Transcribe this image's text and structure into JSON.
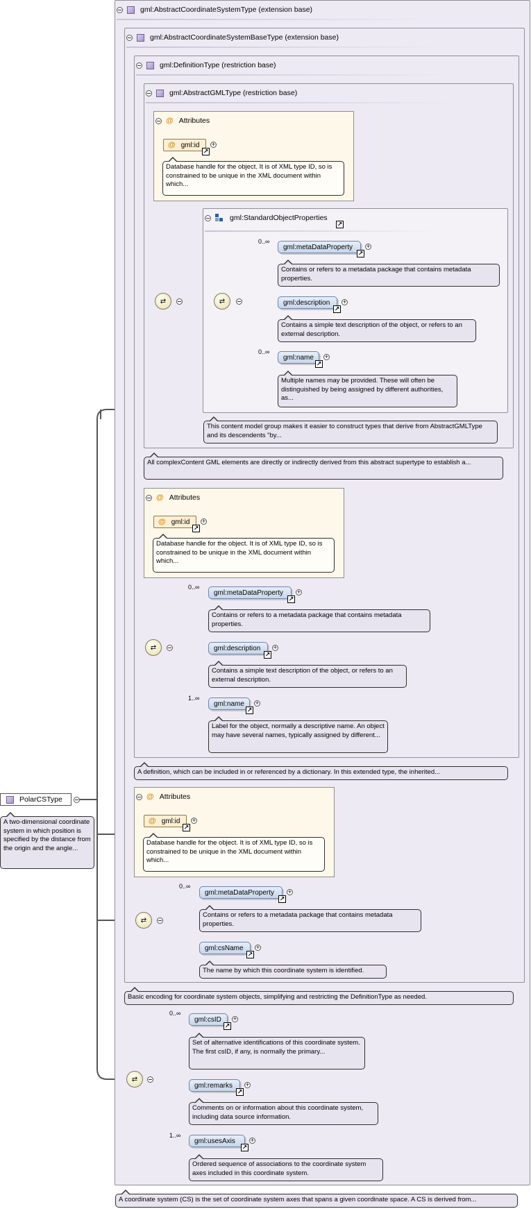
{
  "root": {
    "name": "PolarCSType",
    "doc": "A two-dimensional coordinate system in which position is specified by the distance from the origin and the angle..."
  },
  "types": {
    "cs": {
      "name": "gml:AbstractCoordinateSystemType (extension base)",
      "doc": "A coordinate system (CS) is the set of coordinate system axes that spans a given coordinate space. A CS is derived from..."
    },
    "csbase": {
      "name": "gml:AbstractCoordinateSystemBaseType (extension base)",
      "doc": "Basic encoding for coordinate system objects, simplifying and restricting the DefinitionType as needed."
    },
    "definition": {
      "name": "gml:DefinitionType (restriction base)",
      "doc": "A definition, which can be included in or referenced by a dictionary. In this extended type, the inherited..."
    },
    "gml": {
      "name": "gml:AbstractGMLType (restriction base)",
      "doc": "All complexContent GML elements are directly or indirectly derived from this abstract supertype to establish a..."
    }
  },
  "attributes_label": "Attributes",
  "attr_id": {
    "name": "gml:id",
    "doc": "Database handle for the object. It is of XML type ID, so is constrained to be unique in the XML document within which..."
  },
  "group": {
    "name": "gml:StandardObjectProperties",
    "doc": "This content model group makes it easier to construct types that derive from AbstractGMLType and its descendents \"by..."
  },
  "elements": {
    "metaDataProperty": {
      "name": "gml:metaDataProperty",
      "card": "0..∞",
      "doc": "Contains or refers to a metadata package that contains metadata properties."
    },
    "description": {
      "name": "gml:description",
      "doc": "Contains a simple text description of the object, or refers to an external description."
    },
    "name_group": {
      "name": "gml:name",
      "card": "0..∞",
      "doc": "Multiple names may be provided. These will often be distinguished by being assigned by different authorities, as..."
    },
    "name_def": {
      "name": "gml:name",
      "card": "1..∞",
      "doc": "Label for the object, normally a descriptive name. An object may have several names, typically assigned by different..."
    },
    "csName": {
      "name": "gml:csName",
      "doc": "The name by which this coordinate system is identified."
    },
    "csID": {
      "name": "gml:csID",
      "card": "0..∞",
      "doc": "Set of alternative identifications of this coordinate system. The first csID, if any, is normally the primary..."
    },
    "remarks": {
      "name": "gml:remarks",
      "doc": "Comments on or information about this coordinate system, including data source information."
    },
    "usesAxis": {
      "name": "gml:usesAxis",
      "card": "1..∞",
      "doc": "Ordered sequence of associations to the coordinate system axes included in this coordinate system."
    }
  }
}
